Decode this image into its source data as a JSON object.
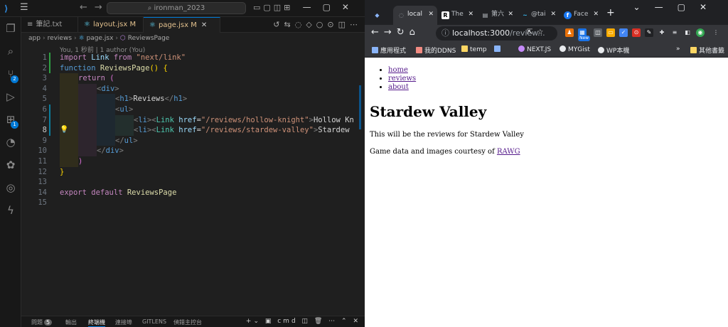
{
  "vscode": {
    "search_text": "ironman_2023",
    "tabs": [
      {
        "label": "筆記.txt",
        "modified": ""
      },
      {
        "label": "layout.jsx",
        "modified": "M"
      },
      {
        "label": "page.jsx",
        "modified": "M"
      }
    ],
    "breadcrumb": [
      "app",
      "reviews",
      "page.jsx",
      "ReviewsPage"
    ],
    "blame": "You, 1 秒前 | 1 author (You)",
    "line_numbers": [
      "1",
      "2",
      "3",
      "4",
      "5",
      "6",
      "7",
      "8",
      "9",
      "10",
      "11",
      "12",
      "13",
      "14",
      "15"
    ],
    "code": {
      "l1": [
        "import",
        "Link",
        "from",
        "\"next/link\""
      ],
      "l2": [
        "function",
        "ReviewsPage",
        "()",
        "{"
      ],
      "l3": [
        "return",
        "("
      ],
      "l4": [
        "<",
        "div",
        ">"
      ],
      "l5": [
        "<",
        "h1",
        ">",
        "Reviews",
        "</",
        "h1",
        ">"
      ],
      "l6": [
        "<",
        "ul",
        ">"
      ],
      "l7": [
        "<",
        "li",
        "><",
        "Link",
        "href",
        "=",
        "\"/reviews/hollow-knight\"",
        ">",
        "Hollow Kn"
      ],
      "l8": [
        "<",
        "li",
        "><",
        "Link",
        "href",
        "=",
        "\"/reviews/stardew-valley\"",
        ">",
        "Stardew"
      ],
      "l9": [
        "</",
        "ul",
        ">"
      ],
      "l10": [
        "</",
        "div",
        ">"
      ],
      "l11": [
        ")"
      ],
      "l12": [
        "}"
      ],
      "l14": [
        "export",
        "default",
        "ReviewsPage"
      ]
    },
    "panel_tabs": [
      "問題",
      "輸出",
      "終端機",
      "連接埠",
      "GITLENS",
      "偵錯主控台"
    ],
    "problems_count": "5",
    "terminal_name": "cmd"
  },
  "chrome": {
    "tabs": [
      {
        "label": "",
        "icon": "◆",
        "color": "#8ab4f8"
      },
      {
        "label": "local",
        "icon": "◌",
        "color": "#9aa0a6"
      },
      {
        "label": "The",
        "icon": "R",
        "color": "#000000"
      },
      {
        "label": "第六",
        "icon": "▤",
        "color": "#9aa0a6"
      },
      {
        "label": "@tai",
        "icon": "~",
        "color": "#38bdf8"
      },
      {
        "label": "Face",
        "icon": "f",
        "color": "#1877f2"
      }
    ],
    "url_host": "localhost:3000",
    "url_path": "/review...",
    "ext_new_badge": "New",
    "bookmarks": [
      "應用程式",
      "我的DDNS",
      "temp",
      "",
      "NEXT.JS",
      "MYGist",
      "WP本機"
    ],
    "other_bookmarks": "其他書籤",
    "page": {
      "nav": [
        "home",
        "reviews",
        "about"
      ],
      "heading": "Stardew Valley",
      "paragraph": "This will be the reviews for Stardew Valley",
      "footer_prefix": "Game data and images courtesy of ",
      "footer_link": "RAWG"
    }
  }
}
